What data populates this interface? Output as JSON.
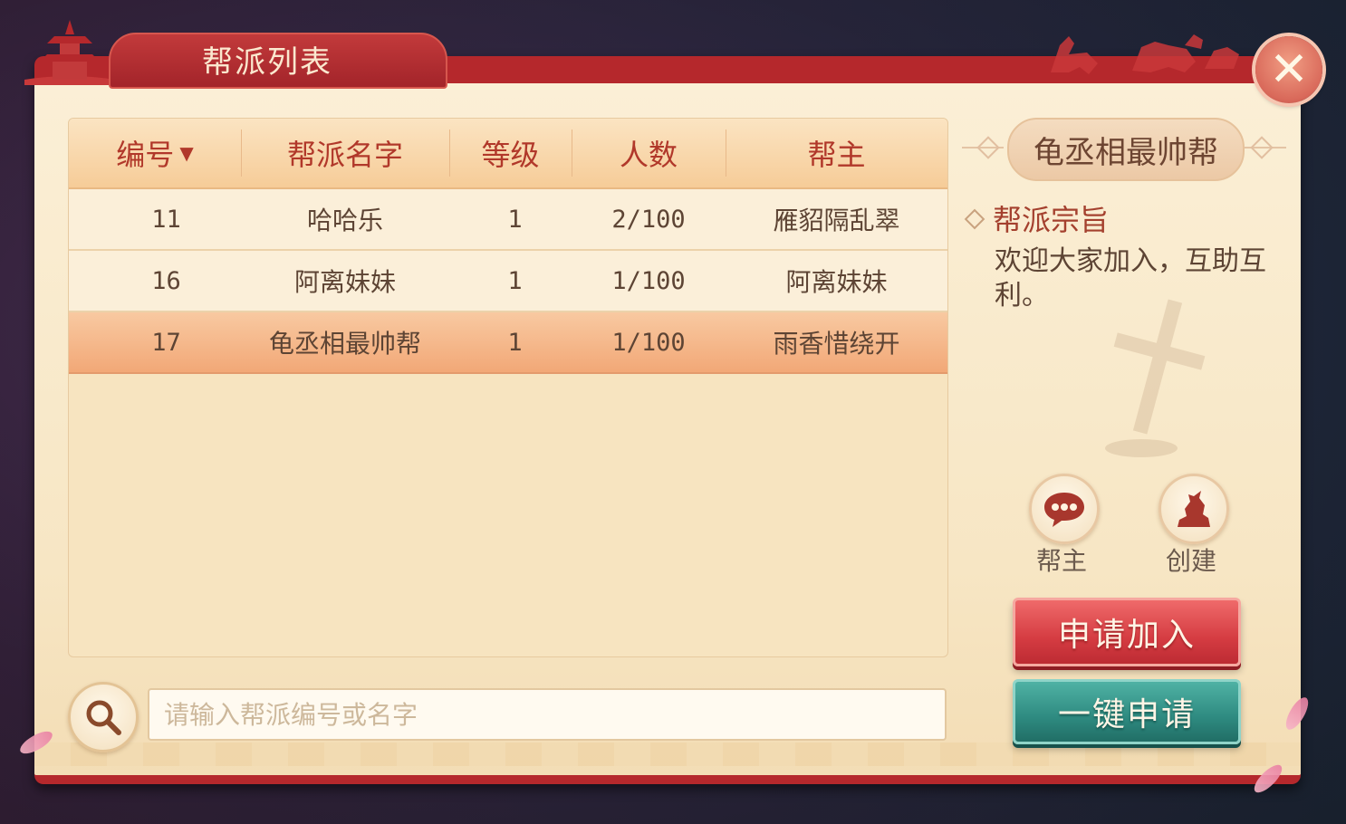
{
  "title": "帮派列表",
  "table": {
    "headers": {
      "id": "编号",
      "sort_indicator": "▼",
      "name": "帮派名字",
      "level": "等级",
      "members": "人数",
      "leader": "帮主"
    },
    "rows": [
      {
        "id": "11",
        "name": "哈哈乐",
        "level": "1",
        "members": "2/100",
        "leader": "雁貂隔乱翠",
        "selected": false
      },
      {
        "id": "16",
        "name": "阿离妹妹",
        "level": "1",
        "members": "1/100",
        "leader": "阿离妹妹",
        "selected": false
      },
      {
        "id": "17",
        "name": "龟丞相最帅帮",
        "level": "1",
        "members": "1/100",
        "leader": "雨香惜绕开",
        "selected": true
      }
    ]
  },
  "search": {
    "placeholder": "请输入帮派编号或名字",
    "value": ""
  },
  "detail": {
    "guild_name": "龟丞相最帅帮",
    "section_title": "帮派宗旨",
    "section_text": "欢迎大家加入，互助互利。"
  },
  "actions": {
    "leader_label": "帮主",
    "create_label": "创建",
    "apply_label": "申请加入",
    "quick_apply_label": "一键申请"
  },
  "colors": {
    "accent_red": "#b5282c",
    "header_text": "#b1382a",
    "selected_row": "#f2a877",
    "apply_button": "#d53c42",
    "quick_apply_button": "#2e8a80"
  },
  "icons": {
    "close": "close-icon",
    "search": "search-icon",
    "chat": "chat-bubble-icon",
    "create": "dragon-statue-icon"
  }
}
